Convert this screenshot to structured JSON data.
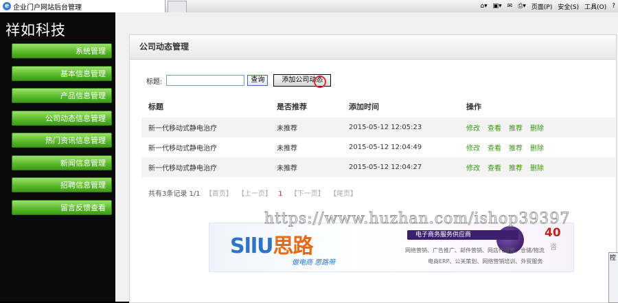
{
  "browser": {
    "tab_title": "企业门户网站后台管理",
    "toolbar": {
      "page_label": "页面(P)",
      "safety_label": "安全(S)",
      "tools_label": "工具(O)"
    }
  },
  "sidebar": {
    "brand": "祥如科技",
    "items": [
      {
        "label": "系统管理"
      },
      {
        "label": "基本信息管理"
      },
      {
        "label": "产品信息管理"
      },
      {
        "label": "公司动态信息管理"
      },
      {
        "label": "热门资讯信息管理"
      },
      {
        "label": "新闻信息管理"
      },
      {
        "label": "招聘信息管理"
      },
      {
        "label": "留言反馈查看"
      }
    ]
  },
  "panel": {
    "title": "公司动态管理",
    "search": {
      "label": "标题:",
      "value": "",
      "query_button": "查询",
      "add_button": "添加公司动态"
    },
    "table": {
      "headers": [
        "标题",
        "是否推荐",
        "添加时间",
        "操作"
      ],
      "rows": [
        {
          "title": "新一代移动式静电治疗",
          "recommend": "未推荐",
          "time": "2015-05-12 12:05:23"
        },
        {
          "title": "新一代移动式静电治疗",
          "recommend": "未推荐",
          "time": "2015-05-12 12:04:49"
        },
        {
          "title": "新一代移动式静电治疗",
          "recommend": "未推荐",
          "time": "2015-05-12 12:04:27"
        }
      ],
      "ops": [
        "修改",
        "查看",
        "推荐",
        "删除"
      ]
    },
    "pager": {
      "summary": "共有3条记录 1/1",
      "first": "【首页】",
      "prev": "【上一页】",
      "current": "1",
      "next": "【下一页】",
      "last": "【尾页】"
    }
  },
  "banner": {
    "logo_en": "SllU",
    "logo_cn": "思路",
    "slogan": "做电商 思路带",
    "pill": "电子商务服务供应商",
    "services1": "网络营销、广告推广、邮件营销、网店代运营、仓储/物流",
    "services2": "电商ERP、公关策划、网络营销培训、外贸服务",
    "number": "40",
    "ask": "咨"
  },
  "watermark": "https://www.huzhan.com/ishop39397",
  "floatwin": {
    "label": "控"
  }
}
